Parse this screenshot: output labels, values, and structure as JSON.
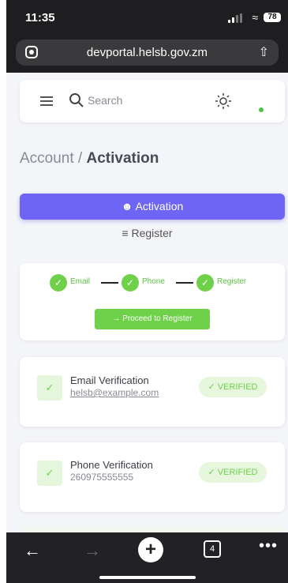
{
  "status_bar": {
    "time": "11:35",
    "battery": "78"
  },
  "browser": {
    "url": "devportal.helsb.gov.zm",
    "tab_count": "4"
  },
  "header": {
    "search_placeholder": "Search"
  },
  "breadcrumb": {
    "parent": "Account /",
    "current": "Activation"
  },
  "buttons": {
    "activation": "Activation",
    "register": "Register",
    "proceed": "Proceed to Register"
  },
  "steps": [
    {
      "label": "Email"
    },
    {
      "label": "Phone"
    },
    {
      "label": "Register"
    }
  ],
  "verifications": [
    {
      "title": "Email Verification",
      "detail": "helsb@example.com",
      "status": "VERIFIED"
    },
    {
      "title": "Phone Verification",
      "detail": "260975555555",
      "status": "VERIFIED"
    }
  ],
  "colors": {
    "primary": "#6f65f4",
    "success": "#6fd14a",
    "success_bg": "#e6f7de",
    "chrome": "#1e1e20"
  },
  "icons": [
    "menu-icon",
    "search-icon",
    "sun-icon",
    "user-check-icon",
    "list-icon",
    "check-icon",
    "arrow-right-icon",
    "back-icon",
    "forward-icon",
    "plus-icon",
    "tabs-icon",
    "more-icon"
  ]
}
